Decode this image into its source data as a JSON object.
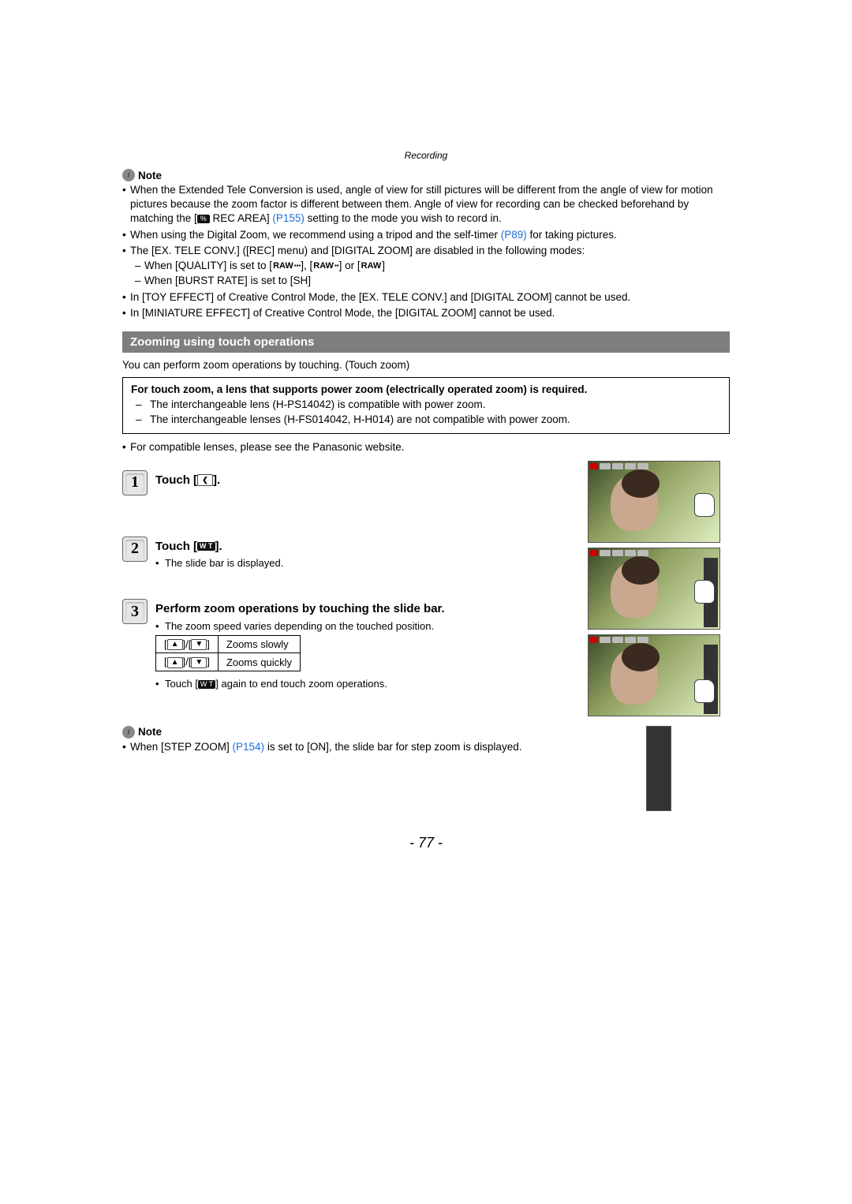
{
  "header": {
    "section": "Recording"
  },
  "note1": {
    "label": "Note",
    "b1a": "When the Extended Tele Conversion is used, angle of view for still pictures will be different from the angle of view for motion pictures because the zoom factor is different between them. Angle of view for recording can be checked beforehand by matching the [",
    "b1_icon": "rec-area-icon",
    "b1b": " REC AREA] ",
    "b1_link": "(P155)",
    "b1c": " setting to the mode you wish to record in.",
    "b2a": "When using the Digital Zoom, we recommend using a tripod and the self-timer ",
    "b2_link": "(P89)",
    "b2b": " for taking pictures.",
    "b3": "The [EX. TELE CONV.] ([REC] menu) and [DIGITAL ZOOM] are disabled in the following modes:",
    "b3s1a": "When [QUALITY] is set to [",
    "b3s1_sep1": "], [",
    "b3s1_sep2": "] or [",
    "b3s1_end": "]",
    "b3s2": "When [BURST RATE] is set to [SH]",
    "b4": "In [TOY EFFECT] of Creative Control Mode, the [EX. TELE CONV.] and [DIGITAL ZOOM] cannot be used.",
    "b5": "In [MINIATURE EFFECT] of Creative Control Mode, the [DIGITAL ZOOM] cannot be used."
  },
  "barHeading": "Zooming using touch operations",
  "touchIntro": "You can perform zoom operations by touching. (Touch zoom)",
  "box": {
    "line1": "For touch zoom, a lens that supports power zoom (electrically operated zoom) is required.",
    "s1": "The interchangeable lens (H-PS14042) is compatible with power zoom.",
    "s2": "The interchangeable lenses (H-FS014042, H-H014) are not compatible with power zoom."
  },
  "afterBox": "For compatible lenses, please see the Panasonic website.",
  "step1": {
    "num": "1",
    "title_a": "Touch [",
    "title_b": "]."
  },
  "step2": {
    "num": "2",
    "title_a": "Touch [",
    "title_b": "].",
    "note": "The slide bar is displayed."
  },
  "step3": {
    "num": "3",
    "title": "Perform zoom operations by touching the slide bar.",
    "note": "The zoom speed varies depending on the touched position.",
    "table": {
      "r1c1a": "[",
      "r1c1b": "]/[",
      "r1c1c": "]",
      "r1c2": "Zooms slowly",
      "r2c1a": "[",
      "r2c1b": "]/[",
      "r2c1c": "]",
      "r2c2": "Zooms quickly"
    },
    "after_a": "Touch [",
    "after_b": "] again to end touch zoom operations."
  },
  "note2": {
    "label": "Note",
    "b1a": "When [STEP ZOOM] ",
    "b1_link": "(P154)",
    "b1b": " is set to [ON], the slide bar for step zoom is displayed."
  },
  "icons": {
    "raw1": "RAW",
    "raw2": "RAW",
    "raw3": "RAW",
    "wt": "W T",
    "tab": "❮"
  },
  "pageNum": "- 77 -"
}
